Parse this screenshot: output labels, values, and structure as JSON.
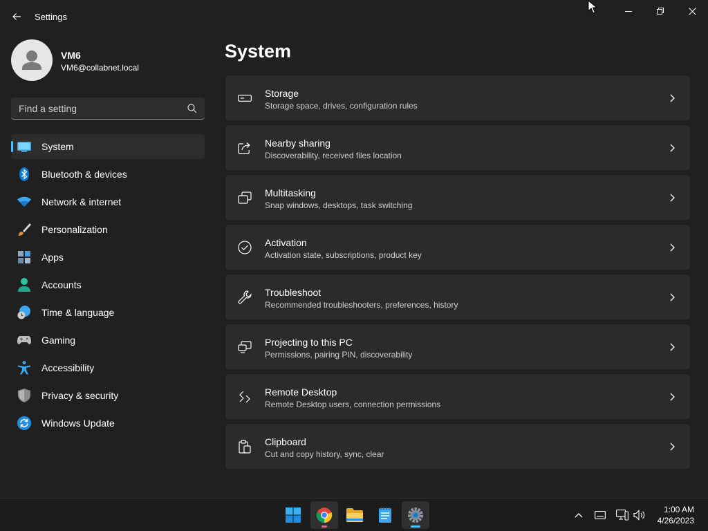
{
  "window": {
    "title": "Settings"
  },
  "profile": {
    "name": "VM6",
    "email": "VM6@collabnet.local"
  },
  "search": {
    "placeholder": "Find a setting"
  },
  "sidebar": {
    "items": [
      {
        "label": "System",
        "icon": "system-icon",
        "selected": true
      },
      {
        "label": "Bluetooth & devices",
        "icon": "bluetooth-icon"
      },
      {
        "label": "Network & internet",
        "icon": "wifi-icon"
      },
      {
        "label": "Personalization",
        "icon": "brush-icon"
      },
      {
        "label": "Apps",
        "icon": "apps-icon"
      },
      {
        "label": "Accounts",
        "icon": "person-icon"
      },
      {
        "label": "Time & language",
        "icon": "globe-clock-icon"
      },
      {
        "label": "Gaming",
        "icon": "gamepad-icon"
      },
      {
        "label": "Accessibility",
        "icon": "accessibility-icon"
      },
      {
        "label": "Privacy & security",
        "icon": "shield-icon"
      },
      {
        "label": "Windows Update",
        "icon": "update-icon"
      }
    ]
  },
  "main": {
    "title": "System",
    "cards": [
      {
        "title": "Storage",
        "subtitle": "Storage space, drives, configuration rules",
        "icon": "storage-icon"
      },
      {
        "title": "Nearby sharing",
        "subtitle": "Discoverability, received files location",
        "icon": "share-icon"
      },
      {
        "title": "Multitasking",
        "subtitle": "Snap windows, desktops, task switching",
        "icon": "multitasking-icon"
      },
      {
        "title": "Activation",
        "subtitle": "Activation state, subscriptions, product key",
        "icon": "check-circle-icon"
      },
      {
        "title": "Troubleshoot",
        "subtitle": "Recommended troubleshooters, preferences, history",
        "icon": "wrench-icon"
      },
      {
        "title": "Projecting to this PC",
        "subtitle": "Permissions, pairing PIN, discoverability",
        "icon": "projecting-icon"
      },
      {
        "title": "Remote Desktop",
        "subtitle": "Remote Desktop users, connection permissions",
        "icon": "remote-desktop-icon"
      },
      {
        "title": "Clipboard",
        "subtitle": "Cut and copy history, sync, clear",
        "icon": "clipboard-icon"
      }
    ]
  },
  "taskbar": {
    "apps": [
      {
        "name": "start-icon"
      },
      {
        "name": "chrome-icon"
      },
      {
        "name": "file-explorer-icon"
      },
      {
        "name": "notepad-icon"
      },
      {
        "name": "settings-icon"
      }
    ],
    "time": "1:00 AM",
    "date": "4/26/2023"
  },
  "colors": {
    "accent": "#4cc2ff",
    "background": "#202020",
    "card": "#2b2b2b"
  }
}
